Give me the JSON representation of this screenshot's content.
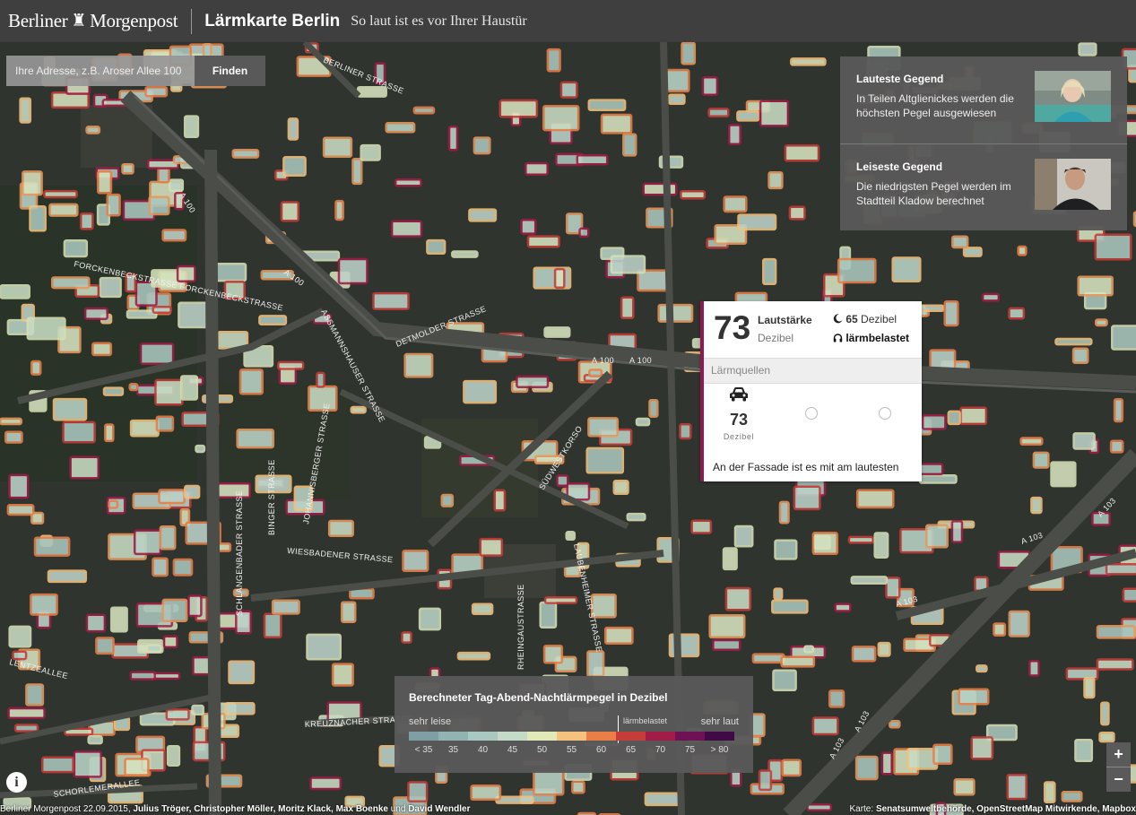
{
  "header": {
    "brand": "Berliner Morgenpost",
    "brand_left": "Berliner",
    "brand_right": "Morgenpost",
    "title": "Lärmkarte Berlin",
    "subtitle": "So laut ist es vor Ihrer Haustür"
  },
  "search": {
    "placeholder": "Ihre Adresse, z.B. Aroser Allee 100",
    "button_label": "Finden"
  },
  "regions": [
    {
      "title": "Lauteste Gegend",
      "text": "In Teilen Altglienickes werden die höchsten Pegel ausgewiesen"
    },
    {
      "title": "Leiseste Gegend",
      "text": "Die niedrigsten Pegel werden im Stadtteil Kladow berechnet"
    }
  ],
  "popup": {
    "value": "73",
    "value_label": "Lautstärke",
    "value_unit": "Dezibel",
    "night_value": "65",
    "night_unit": "Dezibel",
    "burden_label": "lärmbelastet",
    "sources_header": "Lärmquellen",
    "sources": [
      {
        "icon": "car-icon",
        "value": "73",
        "unit": "Dezibel"
      }
    ],
    "facade_note": "An der Fassade ist es mit am lautesten"
  },
  "legend": {
    "title": "Berechneter Tag-Abend-Nachtlärmpegel in Dezibel",
    "quiet_label": "sehr leise",
    "burden_label": "lärmbelastet",
    "loud_label": "sehr laut",
    "ticks": [
      "< 35",
      "35",
      "40",
      "45",
      "50",
      "55",
      "60",
      "65",
      "70",
      "75",
      "> 80"
    ],
    "colors": [
      "#7f9fa4",
      "#93b2b2",
      "#a9c8c2",
      "#c4dcc7",
      "#e2e9b9",
      "#f4c27c",
      "#e97f46",
      "#c53c38",
      "#a11c47",
      "#6e1155",
      "#3f0a45"
    ]
  },
  "map_labels": [
    "A 100",
    "A 100",
    "A 100",
    "A 100",
    "FORCKENBECKSTRASSE FORCKENBECKSTRASSE",
    "DETMOLDER STRASSE",
    "ASSMANNSHAUSER STRASSE",
    "BERLINER STRASSE",
    "WIESBADENER STRASSE",
    "SCHLANGENBADER STRASSE",
    "BINGER STRASSE",
    "JOHANNISBERGER STRASSE",
    "SÜDWESTKORSO",
    "LAUBENHEIMER STRASSE",
    "RHEINGAUSTRASSE",
    "KREUZNACHER STRASSE",
    "LENTZEALLEE",
    "SCHORLEMERALLEE",
    "A 103",
    "A 103",
    "A 103",
    "A 103",
    "A 103"
  ],
  "zoom": {
    "in": "+",
    "out": "−"
  },
  "info_label": "i",
  "credits": {
    "prefix": "Berliner Morgenpost 22.09.2015,",
    "authors": "Julius Tröger, Christopher Möller, Moritz Klack, Max Boenke",
    "and": "und",
    "last_author": "David Wendler"
  },
  "attribution": {
    "prefix": "Karte:",
    "sources": "Senatsumweltbehörde, OpenStreetMap Mitwirkende, Mapbox"
  }
}
